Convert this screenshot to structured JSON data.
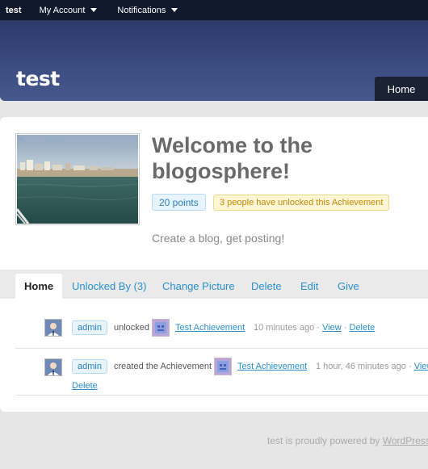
{
  "adminbar": {
    "site_label": "test",
    "account_label": "My Account",
    "notifications_label": "Notifications"
  },
  "header": {
    "site_title": "test",
    "home_tab": "Home"
  },
  "achievement": {
    "title": "Welcome to the blogosphere!",
    "points": "20 points",
    "unlocked_count": "3 people have unlocked this Achievement",
    "description": "Create a blog, get posting!"
  },
  "tabs": [
    {
      "label": "Home"
    },
    {
      "label": "Unlocked By (3)"
    },
    {
      "label": "Change Picture"
    },
    {
      "label": "Delete"
    },
    {
      "label": "Edit"
    },
    {
      "label": "Give"
    }
  ],
  "activity": [
    {
      "user": "admin",
      "action": "unlocked",
      "achievement": "Test Achievement",
      "time": "10 minutes ago",
      "sep": "·",
      "view": "View",
      "delete": "Delete"
    },
    {
      "user": "admin",
      "action": "created the Achievement",
      "achievement": "Test Achievement",
      "time": "1 hour, 46 minutes ago",
      "sep": "·",
      "view": "View",
      "delete": "Delete"
    }
  ],
  "footer": {
    "text": "test is proudly powered by",
    "link": "WordPress"
  },
  "colors": {
    "header_top": "#2d3a6a",
    "header_bottom": "#46588e",
    "link": "#2a8fcc",
    "points_bg": "#e8f4fc",
    "unlock_bg": "#fff6d6"
  }
}
